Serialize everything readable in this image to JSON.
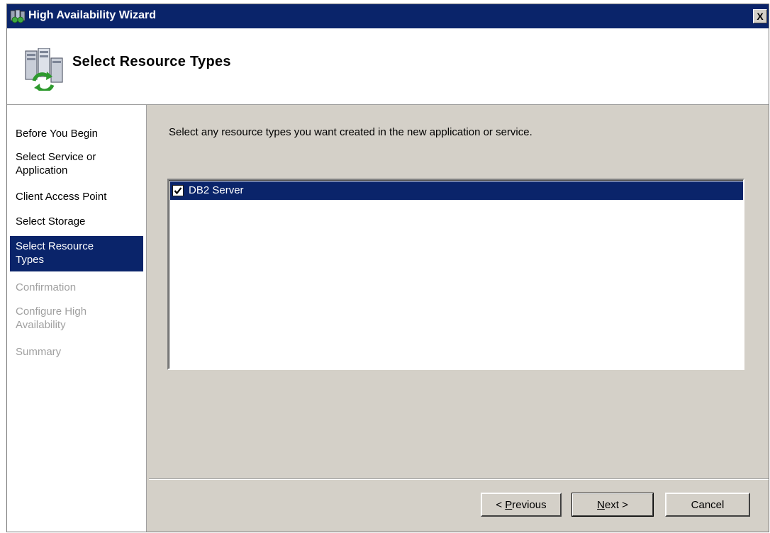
{
  "window": {
    "title": "High Availability Wizard",
    "close_label": "X"
  },
  "header": {
    "page_title": "Select Resource Types"
  },
  "nav": {
    "items": [
      {
        "label": "Before You Begin",
        "state": "normal"
      },
      {
        "label": "Select Service or Application",
        "state": "normal"
      },
      {
        "label": "Client Access Point",
        "state": "normal"
      },
      {
        "label": "Select Storage",
        "state": "normal"
      },
      {
        "label": "Select Resource Types",
        "state": "selected"
      },
      {
        "label": "Confirmation",
        "state": "disabled"
      },
      {
        "label": "Configure High Availability",
        "state": "disabled"
      },
      {
        "label": "Summary",
        "state": "disabled"
      }
    ]
  },
  "content": {
    "instruction": "Select any resource types you want created in the new application or service.",
    "resource_types": [
      {
        "label": "DB2 Server",
        "checked": true,
        "selected": true
      }
    ]
  },
  "buttons": {
    "previous": {
      "accel": "P",
      "rest": "revious",
      "prefix": "< "
    },
    "next": {
      "accel": "N",
      "rest": "ext",
      "suffix": " >"
    },
    "cancel": "Cancel"
  },
  "colors": {
    "selection": "#0a246a",
    "dialog_face": "#d4d0c8",
    "disabled_text": "#a0a0a0"
  },
  "icons": {
    "title": "cluster-wizard-icon",
    "header": "server-cluster-icon",
    "checkmark": "checkmark-icon"
  }
}
